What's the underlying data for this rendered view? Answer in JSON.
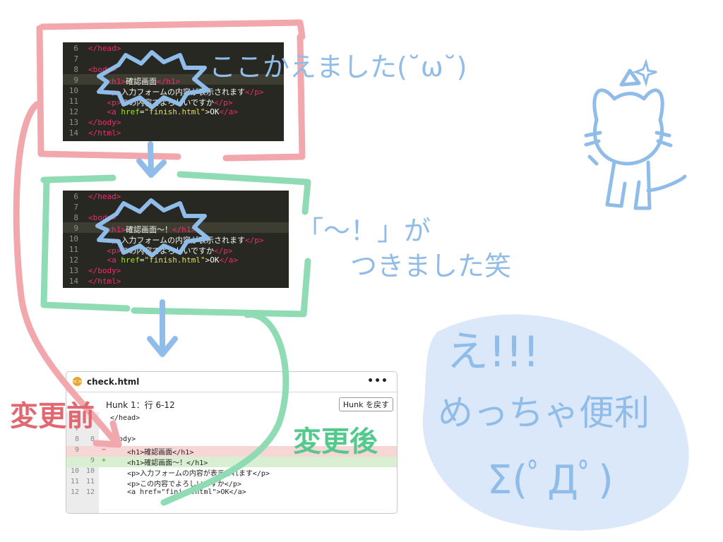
{
  "editor_before": {
    "lines": [
      {
        "num": "6",
        "html_parts": [
          [
            "tag",
            "</head>"
          ]
        ]
      },
      {
        "num": "7",
        "html_parts": []
      },
      {
        "num": "8",
        "html_parts": [
          [
            "tag",
            "<body>"
          ]
        ]
      },
      {
        "num": "9",
        "indent": "    ",
        "html_parts": [
          [
            "tag",
            "<h1>"
          ],
          [
            "text",
            "確認画面"
          ],
          [
            "tag",
            "</h1>"
          ]
        ]
      },
      {
        "num": "10",
        "indent": "    ",
        "html_parts": [
          [
            "tag",
            "<p>"
          ],
          [
            "text",
            "入力フォームの内容が表示されます"
          ],
          [
            "tag",
            "</p>"
          ]
        ]
      },
      {
        "num": "11",
        "indent": "    ",
        "html_parts": [
          [
            "tag",
            "<p>"
          ],
          [
            "text",
            "この内容でよろしいですか"
          ],
          [
            "tag",
            "</p>"
          ]
        ]
      },
      {
        "num": "12",
        "indent": "    ",
        "html_parts": [
          [
            "tag",
            "<a "
          ],
          [
            "attr",
            "href"
          ],
          [
            "text",
            "="
          ],
          [
            "str",
            "\"finish.html\""
          ],
          [
            "text",
            ">OK"
          ],
          [
            "tag",
            "</a>"
          ]
        ]
      },
      {
        "num": "13",
        "html_parts": [
          [
            "tag",
            "</body>"
          ]
        ]
      },
      {
        "num": "14",
        "html_parts": [
          [
            "tag",
            "</html>"
          ]
        ]
      }
    ]
  },
  "editor_after": {
    "lines": [
      {
        "num": "6",
        "html_parts": [
          [
            "tag",
            "</head>"
          ]
        ]
      },
      {
        "num": "7",
        "html_parts": []
      },
      {
        "num": "8",
        "html_parts": [
          [
            "tag",
            "<body>"
          ]
        ]
      },
      {
        "num": "9",
        "indent": "    ",
        "html_parts": [
          [
            "tag",
            "<h1>"
          ],
          [
            "text",
            "確認画面〜！"
          ],
          [
            "tag",
            "</h1>"
          ]
        ]
      },
      {
        "num": "10",
        "indent": "    ",
        "html_parts": [
          [
            "tag",
            "<p>"
          ],
          [
            "text",
            "入力フォームの内容が表示されます"
          ],
          [
            "tag",
            "</p>"
          ]
        ]
      },
      {
        "num": "11",
        "indent": "    ",
        "html_parts": [
          [
            "tag",
            "<p>"
          ],
          [
            "text",
            "この内容でよろしいですか"
          ],
          [
            "tag",
            "</p>"
          ]
        ]
      },
      {
        "num": "12",
        "indent": "    ",
        "html_parts": [
          [
            "tag",
            "<a "
          ],
          [
            "attr",
            "href"
          ],
          [
            "text",
            "="
          ],
          [
            "str",
            "\"finish.html\""
          ],
          [
            "text",
            ">OK"
          ],
          [
            "tag",
            "</a>"
          ]
        ]
      },
      {
        "num": "13",
        "html_parts": [
          [
            "tag",
            "</body>"
          ]
        ]
      },
      {
        "num": "14",
        "html_parts": [
          [
            "tag",
            "</html>"
          ]
        ]
      }
    ]
  },
  "annotations": {
    "changed_here": "ここかえました(˘ω˘)",
    "tilde_added_1": "「〜！」が",
    "tilde_added_2": "つきました笑",
    "before_label": "変更前",
    "after_label": "変更後",
    "wow_1": "え!!!",
    "wow_2": "めっちゃ便利",
    "wow_3": "Σ(ﾟДﾟ)"
  },
  "diff_panel": {
    "filename": "check.html",
    "more_icon": "•••",
    "hunk_label": "Hunk 1：行 6-12",
    "revert_label": "Hunk を戻す",
    "rows": [
      {
        "old": "6",
        "new": "",
        "sign": "",
        "text": "</head>",
        "kind": "ctx"
      },
      {
        "old": "7",
        "new": "",
        "sign": "",
        "text": "",
        "kind": "ctx"
      },
      {
        "old": "8",
        "new": "8",
        "sign": "",
        "text": "<body>",
        "kind": "ctx"
      },
      {
        "old": "9",
        "new": "",
        "sign": "−",
        "text": "    <h1>確認画面</h1>",
        "kind": "del"
      },
      {
        "old": "",
        "new": "9",
        "sign": "+",
        "text": "    <h1>確認画面〜！</h1>",
        "kind": "add"
      },
      {
        "old": "10",
        "new": "10",
        "sign": "",
        "text": "    <p>入力フォームの内容が表示されます</p>",
        "kind": "ctx"
      },
      {
        "old": "11",
        "new": "11",
        "sign": "",
        "text": "    <p>この内容でよろしいですか</p>",
        "kind": "ctx"
      },
      {
        "old": "12",
        "new": "12",
        "sign": "",
        "text": "    <a href=\"finish.html\">OK</a>",
        "kind": "ctx"
      }
    ]
  },
  "colors": {
    "pink_marker": "#f2a7ad",
    "green_marker": "#8fdcb4",
    "blue_marker": "#8fbce8",
    "red_text": "#e06870",
    "green_text": "#54c98e",
    "light_blue_fill": "#d6e6f8"
  }
}
